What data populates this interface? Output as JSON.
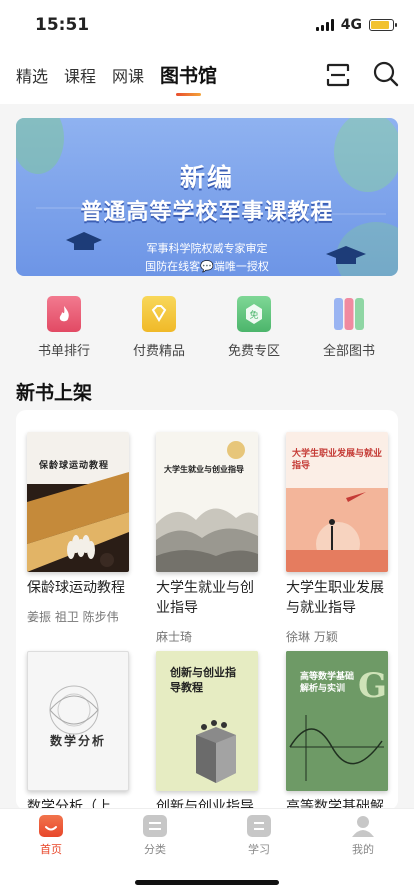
{
  "status_bar": {
    "time": "15:51",
    "network": "4G",
    "battery_level": 0.85
  },
  "nav": {
    "tabs": [
      {
        "label": "精选",
        "active": false
      },
      {
        "label": "课程",
        "active": false
      },
      {
        "label": "网课",
        "active": false
      },
      {
        "label": "图书馆",
        "active": true
      }
    ],
    "icons": [
      "scan-icon",
      "search-icon"
    ]
  },
  "banner": {
    "title_line1": "新编",
    "title_line2": "普通高等学校军事课教程",
    "subtitle_line1": "军事科学院权威专家审定",
    "subtitle_line2": "国防在线客💬端唯一授权"
  },
  "categories": [
    {
      "label": "书单排行",
      "icon": "flame-book-icon",
      "color": "#e8506a"
    },
    {
      "label": "付费精品",
      "icon": "diamond-book-icon",
      "color": "#f2c230"
    },
    {
      "label": "免费专区",
      "icon": "free-book-icon",
      "color": "#5cc07a"
    },
    {
      "label": "全部图书",
      "icon": "bookshelf-icon",
      "color": "#8c8ff0"
    }
  ],
  "section": {
    "title": "新书上架"
  },
  "books": [
    {
      "title": "保龄球运动教程",
      "author": "姜振 祖卫 陈步伟",
      "cover_text": "保龄球运动教程"
    },
    {
      "title": "大学生就业与创业指导",
      "author": "麻士琦",
      "cover_text": "大学生就业与创业指导"
    },
    {
      "title": "大学生职业发展与就业指导",
      "author": "徐琳 万颖",
      "cover_text": "大学生职业发展与就业指导"
    },
    {
      "title": "数学分析（上",
      "author": "",
      "cover_text": "数学分析"
    },
    {
      "title": "创新与创业指导",
      "author": "",
      "cover_text": "创新与创业指导教程"
    },
    {
      "title": "高等数学基础解",
      "author": "",
      "cover_text": "高等数学基础解析与实训"
    }
  ],
  "tabbar": [
    {
      "label": "首页",
      "icon": "home-icon",
      "active": true
    },
    {
      "label": "分类",
      "icon": "category-icon",
      "active": false
    },
    {
      "label": "学习",
      "icon": "study-icon",
      "active": false
    },
    {
      "label": "我的",
      "icon": "profile-icon",
      "active": false
    }
  ]
}
